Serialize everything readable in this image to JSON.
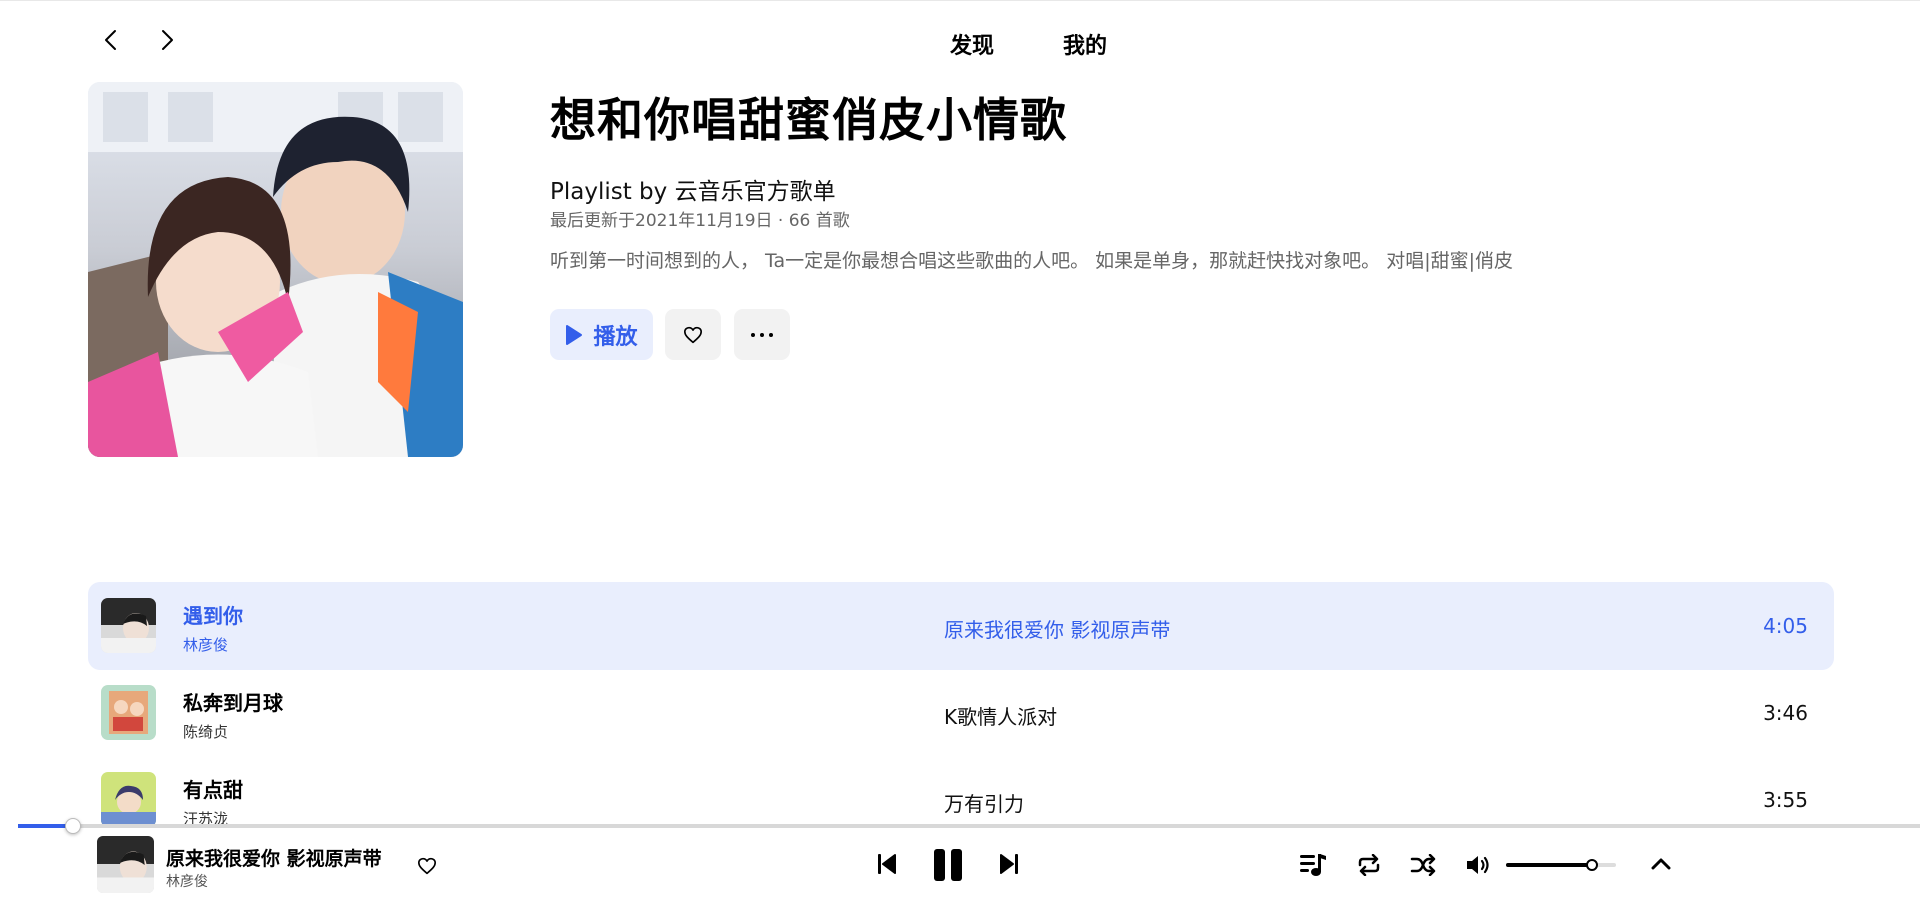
{
  "nav": {
    "tabs": [
      "发现",
      "我的"
    ]
  },
  "playlist": {
    "title": "想和你唱甜蜜俏皮小情歌",
    "byline": "Playlist by 云音乐官方歌单",
    "meta": "最后更新于2021年11月19日 · 66 首歌",
    "description": "听到第一时间想到的人， Ta一定是你最想合唱这些歌曲的人吧。 如果是单身，那就赶快找对象吧。 对唱|甜蜜|俏皮",
    "play_label": "播放"
  },
  "tracks": [
    {
      "name": "遇到你",
      "artist": "林彦俊",
      "album": "原来我很爱你 影视原声带",
      "duration": "4:05",
      "active": true
    },
    {
      "name": "私奔到月球",
      "artist": "陈绮贞",
      "album": "K歌情人派对",
      "duration": "3:46",
      "active": false
    },
    {
      "name": "有点甜",
      "artist": "汪苏泷",
      "album": "万有引力",
      "duration": "3:55",
      "active": false
    }
  ],
  "player": {
    "title": "原来我很爱你 影视原声带",
    "artist": "林彦俊",
    "progress": 0.029,
    "volume": 0.78
  },
  "colors": {
    "accent": "#335eea",
    "accent_bg": "#e9eefd",
    "button_bg": "#f2f2f2"
  },
  "icons": [
    "back-arrow-icon",
    "forward-arrow-icon",
    "play-icon",
    "heart-icon",
    "more-icon",
    "previous-icon",
    "pause-icon",
    "next-icon",
    "playlist-icon",
    "repeat-icon",
    "shuffle-icon",
    "volume-icon",
    "chevron-up-icon"
  ]
}
